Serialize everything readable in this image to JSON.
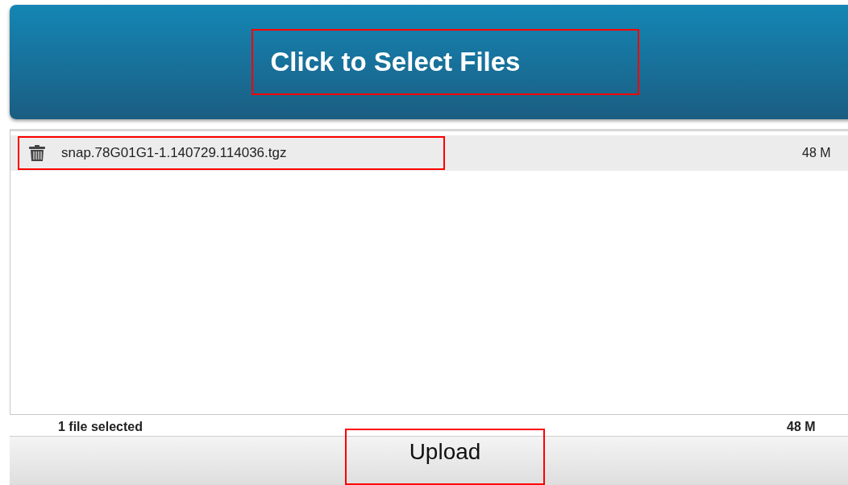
{
  "select_button": {
    "label": "Click to Select Files",
    "highlighted": true
  },
  "files": [
    {
      "name": "snap.78G01G1-1.140729.114036.tgz",
      "size": "48 M",
      "highlighted": true
    }
  ],
  "summary": {
    "count": "1 file selected",
    "total_size": "48 M"
  },
  "upload_button": {
    "label": "Upload",
    "highlighted": true
  }
}
